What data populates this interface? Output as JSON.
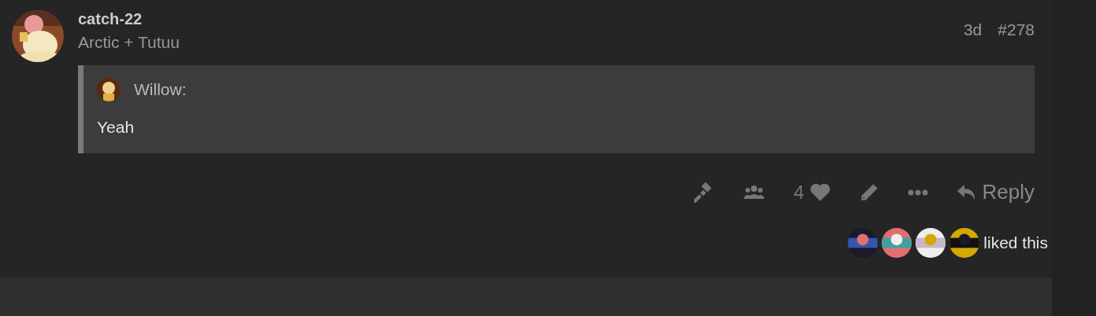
{
  "post": {
    "username": "catch-22",
    "user_title": "Arctic + Tutuu",
    "age": "3d",
    "post_number": "#278",
    "quote": {
      "username": "Willow:",
      "text": "Yeah"
    },
    "like_count": "4",
    "reply_label": "Reply",
    "liked_text": "liked this"
  }
}
